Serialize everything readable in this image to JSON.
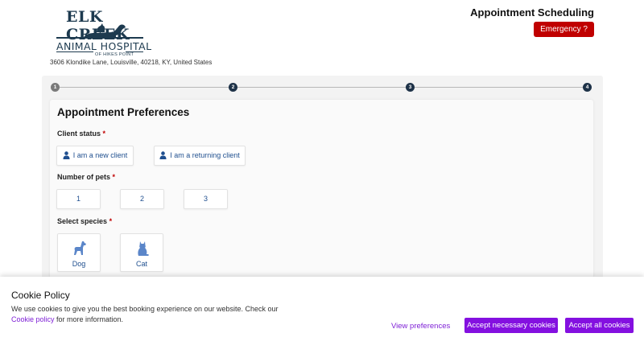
{
  "header": {
    "logo": {
      "line1": "ELK CREEK",
      "line2": "ANIMAL HOSPITAL",
      "line3": "OF HIKES POINT"
    },
    "address": "3606 Klondike Lane, Louisville, 40218, KY, United States",
    "title": "Appointment Scheduling",
    "emergency_label": "Emergency ?",
    "emergency_color": "#c00000"
  },
  "stepper": {
    "steps": [
      "1",
      "2",
      "3",
      "4"
    ],
    "current_step": 1
  },
  "form": {
    "title": "Appointment Preferences",
    "client_status": {
      "label": "Client status",
      "required_mark": "*",
      "options": [
        "I am a new client",
        "I am a returning client"
      ]
    },
    "number_of_pets": {
      "label": "Number of pets",
      "required_mark": "*",
      "options": [
        "1",
        "2",
        "3"
      ]
    },
    "species": {
      "label": "Select species",
      "required_mark": "*",
      "options": [
        {
          "label": "Dog",
          "icon": "dog-icon"
        },
        {
          "label": "Cat",
          "icon": "cat-icon"
        }
      ]
    },
    "accent_color": "#1f4f8f"
  },
  "cookie_banner": {
    "title": "Cookie Policy",
    "text_line1": "We use cookies to give you the best booking experience on our website. Check our",
    "link_text": "Cookie policy",
    "text_line2_suffix": " for more information.",
    "view_preferences": "View preferences",
    "accept_necessary": "Accept necessary cookies",
    "accept_all": "Accept all cookies",
    "accent_color": "#8410e0"
  }
}
